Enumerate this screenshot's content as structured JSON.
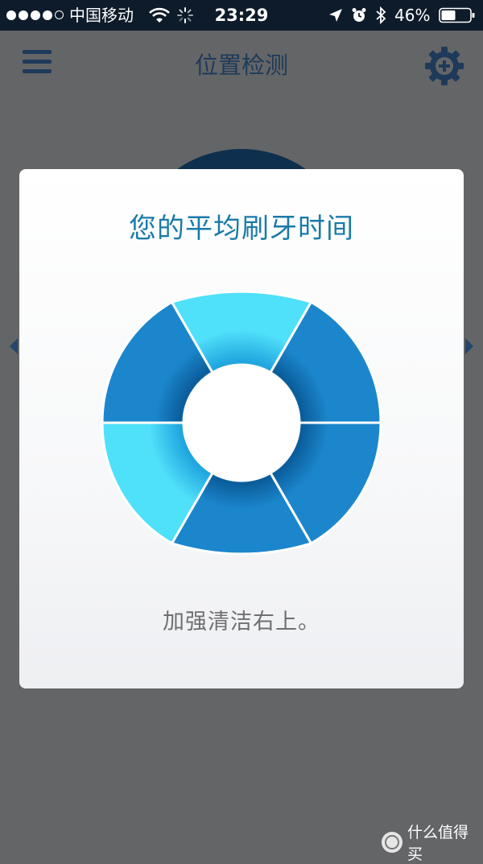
{
  "status_bar": {
    "carrier": "中国移动",
    "time": "23:29",
    "battery": "46%",
    "icons": [
      "signal-dots",
      "wifi-icon",
      "activity-spinner-icon",
      "location-arrow-icon",
      "alarm-clock-icon",
      "bluetooth-icon",
      "battery-icon"
    ]
  },
  "nav": {
    "title": "位置检测",
    "menu_icon": "hamburger-menu-icon",
    "settings_icon": "gear-plus-icon"
  },
  "card": {
    "title": "您的平均刷牙时间",
    "message": "加强清洁右上。",
    "zones": [
      {
        "zone": "upper-left",
        "level": "dark"
      },
      {
        "zone": "upper-center",
        "level": "light"
      },
      {
        "zone": "upper-right",
        "level": "dark"
      },
      {
        "zone": "lower-right",
        "level": "dark"
      },
      {
        "zone": "lower-center",
        "level": "dark"
      },
      {
        "zone": "lower-left",
        "level": "light"
      }
    ]
  },
  "colors": {
    "status_bar_bg": "#0d1b2a",
    "overlay_bg": "#646567",
    "nav_accent": "#1e3a5a",
    "title_color": "#1a7ba8",
    "zone_dark": "#1b86cc",
    "zone_light": "#4fe0fa"
  },
  "watermark": {
    "logo_glyph": "值",
    "text": "什么值得买"
  }
}
